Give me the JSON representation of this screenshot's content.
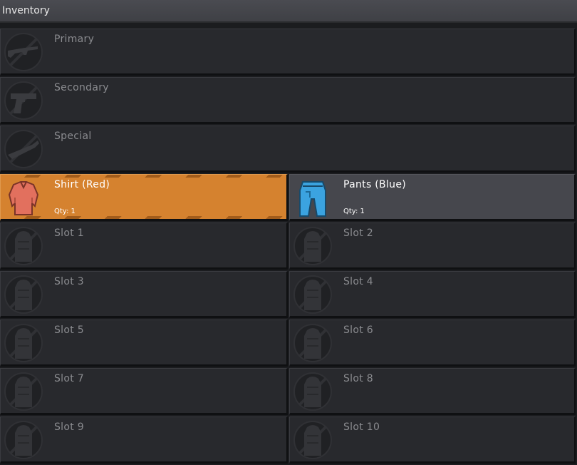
{
  "window": {
    "title": "Inventory"
  },
  "weapon_slots": [
    {
      "label": "Primary",
      "icon": "rifle-icon"
    },
    {
      "label": "Secondary",
      "icon": "pistol-icon"
    },
    {
      "label": "Special",
      "icon": "launcher-icon"
    }
  ],
  "equipped": [
    {
      "label": "Shirt (Red)",
      "qty": "Qty: 1",
      "icon": "shirt-icon",
      "color": "#d5822f",
      "item_color": "#e2705e"
    },
    {
      "label": "Pants (Blue)",
      "qty": "Qty: 1",
      "icon": "pants-icon",
      "color": "#46474d",
      "item_color": "#3ba3e0"
    }
  ],
  "storage_slots": [
    {
      "label": "Slot 1"
    },
    {
      "label": "Slot 2"
    },
    {
      "label": "Slot 3"
    },
    {
      "label": "Slot 4"
    },
    {
      "label": "Slot 5"
    },
    {
      "label": "Slot 6"
    },
    {
      "label": "Slot 7"
    },
    {
      "label": "Slot 8"
    },
    {
      "label": "Slot 9"
    },
    {
      "label": "Slot 10"
    }
  ]
}
